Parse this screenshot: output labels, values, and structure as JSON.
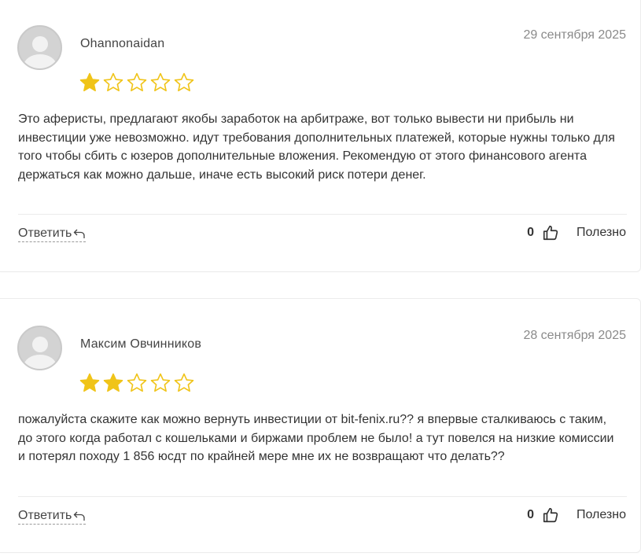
{
  "reviews": [
    {
      "author": "Ohannonaidan",
      "date": "29 сентября 2025",
      "rating": 1,
      "max_rating": 5,
      "text": "Это аферисты, предлагают якобы заработок на арбитраже, вот только вывести ни прибыль ни инвестиции уже невозможно. идут требования дополнительных платежей, которые нужны только для того чтобы сбить с юзеров дополнительные вложения. Рекомендую от этого финансового агента держаться как можно дальше, иначе есть высокий риск потери денег.",
      "reply_label": "Ответить",
      "helpful_count": "0",
      "helpful_label": "Полезно"
    },
    {
      "author": "Максим Овчинников",
      "date": "28 сентября 2025",
      "rating": 2,
      "max_rating": 5,
      "text": "пожалуйста скажите как можно вернуть инвестиции от bit-fenix.ru?? я впервые сталкиваюсь с таким, до этого когда работал с кошельками и биржами проблем не было! а тут повелся на низкие комиссии и потерял походу 1 856 юсдт по крайней мере мне их не возвращают что делать??",
      "reply_label": "Ответить",
      "helpful_count": "0",
      "helpful_label": "Полезно"
    }
  ],
  "colors": {
    "star_filled": "#f0c419",
    "star_empty_stroke": "#f0c419",
    "date": "#8a8a8a",
    "border": "#ececec"
  },
  "icons": {
    "avatar": "default-user-avatar",
    "star": "star-icon",
    "reply": "reply-arrow-icon",
    "thumb": "thumbs-up-icon"
  }
}
